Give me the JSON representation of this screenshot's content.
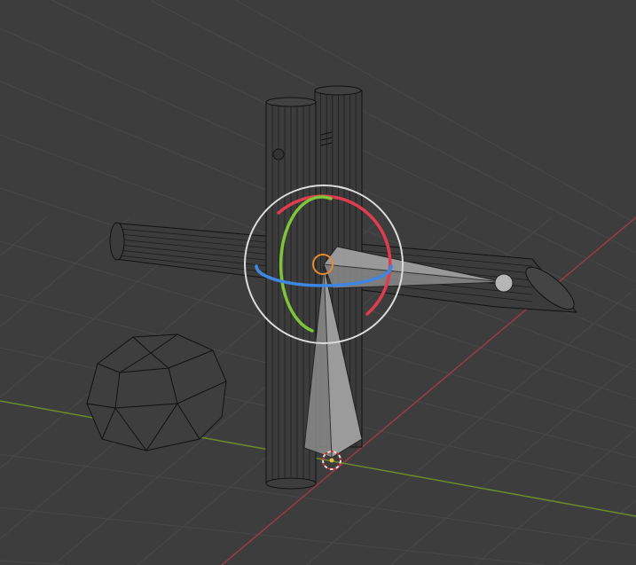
{
  "viewport": {
    "name": "3D Viewport",
    "colors": {
      "background": "#3d3d3d",
      "grid": "#4a4a4a",
      "x_axis": "#9a3b45",
      "y_axis": "#6b8a2e",
      "wire": "#111111",
      "gizmo_x": "#e03c50",
      "gizmo_y": "#7ec53a",
      "gizmo_z": "#3f86e0",
      "gizmo_view": "#dddddd",
      "origin": "#e88a2e",
      "bone": "#8a8a8a"
    },
    "objects": [
      "cylinder-vertical-1",
      "cylinder-vertical-2",
      "cylinder-horizontal",
      "dome-mesh",
      "armature-bones",
      "light-cursor"
    ],
    "icons": [
      "rotate-gizmo-icon",
      "3d-cursor-icon",
      "object-origin-icon"
    ]
  }
}
